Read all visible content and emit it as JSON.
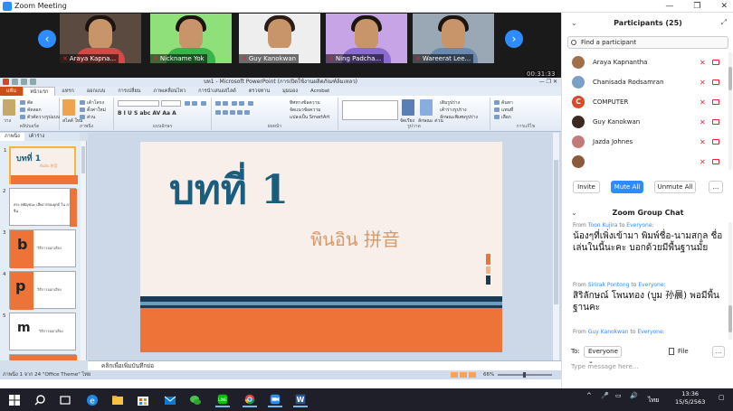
{
  "window": {
    "title": "Zoom Meeting",
    "controls": [
      "—",
      "❐",
      "✕"
    ]
  },
  "video_strip": {
    "tiles": [
      {
        "name": "Araya Kapna...",
        "hair": "#1c1410",
        "body": "#d64747",
        "bg": "#5b4a40"
      },
      {
        "name": "Nickname Yok",
        "hair": "#1c1410",
        "body": "#39b34a",
        "bg": "#8fe07a"
      },
      {
        "name": "Guy Kanokwan",
        "hair": "#2a1c16",
        "body": "#eeeeee",
        "bg": "#eeeeee"
      },
      {
        "name": "Ning Padcha...",
        "hair": "#1c1410",
        "body": "#8a6ccf",
        "bg": "#c7a4e6"
      },
      {
        "name": "Wareerat Lee...",
        "hair": "#1c1410",
        "body": "#6b89b0",
        "bg": "#9aa7b4"
      }
    ],
    "timer": "00:31:33"
  },
  "ppt": {
    "title": "บท1 - Microsoft PowerPoint (การเปิดใช้งานผลิตภัณฑ์ล้มเหลว)",
    "tabs": [
      "แฟ้ม",
      "หน้าแรก",
      "แทรก",
      "ออกแบบ",
      "การเปลี่ยน",
      "ภาพเคลื่อนไหว",
      "การนำเสนอสไลด์",
      "ตรวจทาน",
      "มุมมอง",
      "Acrobat"
    ],
    "ribbon_groups": [
      "คลิปบอร์ด",
      "ภาพนิ่ง",
      "แบบอักษร",
      "ย่อหน้า",
      "รูปวาด",
      "การแก้ไข"
    ],
    "ribbon_labels": {
      "paste": "วาง",
      "new_slide": "สไลด์\nใหม่",
      "layout": "เค้าโครง",
      "reset": "ตั้งค่าใหม่",
      "section": "ส่วน",
      "cut": "ตัด",
      "copy": "คัดลอก",
      "format_painter": "ตัวคัดวางรูปแบบ",
      "text_direction": "ทิศทางข้อความ",
      "align_text": "จัดแนวข้อความ",
      "smartart": "แปลงเป็น SmartArt",
      "arrange": "จัดเรียง",
      "quick_styles": "ลักษณะ\nด่วน",
      "shape_fill": "เติมรูปร่าง",
      "shape_outline": "เค้าร่างรูปร่าง",
      "shape_effects": "ลักษณะพิเศษรูปร่าง",
      "find": "ค้นหา",
      "replace": "แทนที่",
      "select": "เลือก"
    },
    "panel_tabs": [
      "ภาพนิ่ง",
      "เค้าร่าง"
    ],
    "thumbnails": [
      {
        "num": "1",
        "text": "บทที่ 1",
        "sub": "พินอิน 拼音"
      },
      {
        "num": "2",
        "text": "",
        "sub": "สระ พยัญชนะ เสียงวรรณยุกต์ ใน ภาษาจีน"
      },
      {
        "num": "3",
        "text": "b",
        "sub": "วิธีการออกเสียง"
      },
      {
        "num": "4",
        "text": "p",
        "sub": "วิธีการออกเสียง"
      },
      {
        "num": "5",
        "text": "m",
        "sub": "วิธีการออกเสียง"
      }
    ],
    "slide": {
      "heading": "บทที่ 1",
      "subtitle": "พินอิน 拼音"
    },
    "notes_placeholder": "คลิกเพื่อเพิ่มบันทึกย่อ",
    "status": {
      "slide_info": "ภาพนิ่ง 1 จาก 24",
      "theme": "\"Office Theme\"",
      "language": "ไทย",
      "zoom": "66%"
    }
  },
  "participants": {
    "title": "Participants (25)",
    "search_placeholder": "Find a participant",
    "list": [
      {
        "name": "Araya Kapnantha",
        "avatar": "photo"
      },
      {
        "name": "Chanisada Rodsamran",
        "avatar": "flower"
      },
      {
        "name": "COMPUTER",
        "avatar": "C"
      },
      {
        "name": "Guy Kanokwan",
        "avatar": "photo"
      },
      {
        "name": "Jazda Johnes",
        "avatar": "photo"
      },
      {
        "name": "",
        "avatar": "photo"
      }
    ],
    "buttons": {
      "invite": "Invite",
      "mute_all": "Mute All",
      "unmute_all": "Unmute All",
      "more": "..."
    }
  },
  "chat": {
    "title": "Zoom Group Chat",
    "messages": [
      {
        "from_label": "From",
        "sender": "Toon Kujira",
        "to_label": "to",
        "recipient": "Everyone:",
        "text": "น้องๆที่เพิ่งเข้ามา พิมพ์ชื่อ-นามสกุล ชื่อเล่นในนี้นะคะ บอกด้วยมีพื้นฐานมั้ย"
      },
      {
        "from_label": "From",
        "sender": "Sirirak Pontong",
        "to_label": "to",
        "recipient": "Everyone:",
        "text": "สิริลักษณ์ โพนทอง (บูม 孙晨) พอมีพื้นฐานคะ"
      },
      {
        "from_label": "From",
        "sender": "Guy Kanokwan",
        "to_label": "to",
        "recipient": "Everyone:",
        "text": ""
      }
    ],
    "to_label": "To:",
    "to_value": "Everyone",
    "file_label": "File",
    "more": "...",
    "input_placeholder": "Type message here..."
  },
  "taskbar": {
    "time": "13:36",
    "date": "15/5/2563",
    "lang": "ไทย"
  }
}
